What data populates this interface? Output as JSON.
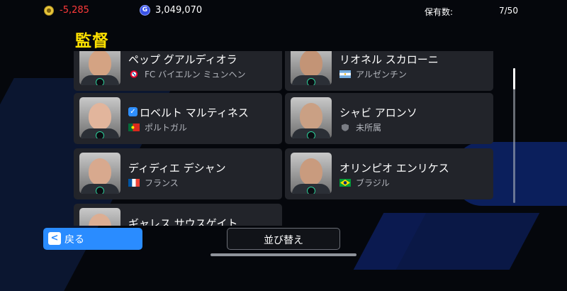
{
  "header": {
    "coin_icon": "coin-icon",
    "coins": "-5,285",
    "gp_icon": "gp-icon",
    "gp_glyph": "G",
    "gp": "3,049,070",
    "owned_label": "保有数:",
    "owned_value": "7/50"
  },
  "title": "監督",
  "managers": [
    {
      "name": "ペップ グアルディオラ",
      "team": "FC バイエルン ミュンヘン",
      "flag_icon": "bayern-crest-icon",
      "checked": false
    },
    {
      "name": "リオネル スカローニ",
      "team": "アルゼンチン",
      "flag_icon": "argentina-flag-icon",
      "checked": false
    },
    {
      "name": "ロベルト マルティネス",
      "team": "ポルトガル",
      "flag_icon": "portugal-flag-icon",
      "checked": true
    },
    {
      "name": "シャビ アロンソ",
      "team": "未所属",
      "flag_icon": "shield-icon",
      "checked": false
    },
    {
      "name": "ディディエ デシャン",
      "team": "フランス",
      "flag_icon": "france-flag-icon",
      "checked": false
    },
    {
      "name": "オリンピオ エンリケス",
      "team": "ブラジル",
      "flag_icon": "brazil-flag-icon",
      "checked": false
    },
    {
      "name": "ギャレス サウスゲイト",
      "team": "",
      "flag_icon": "",
      "checked": false
    }
  ],
  "footer": {
    "back_label": "戻る",
    "sort_label": "並び替え"
  },
  "colors": {
    "accent_blue": "#2a8cff",
    "title_yellow": "#ffe100",
    "negative_red": "#ff3a3a",
    "card_bg": "#22242a"
  }
}
